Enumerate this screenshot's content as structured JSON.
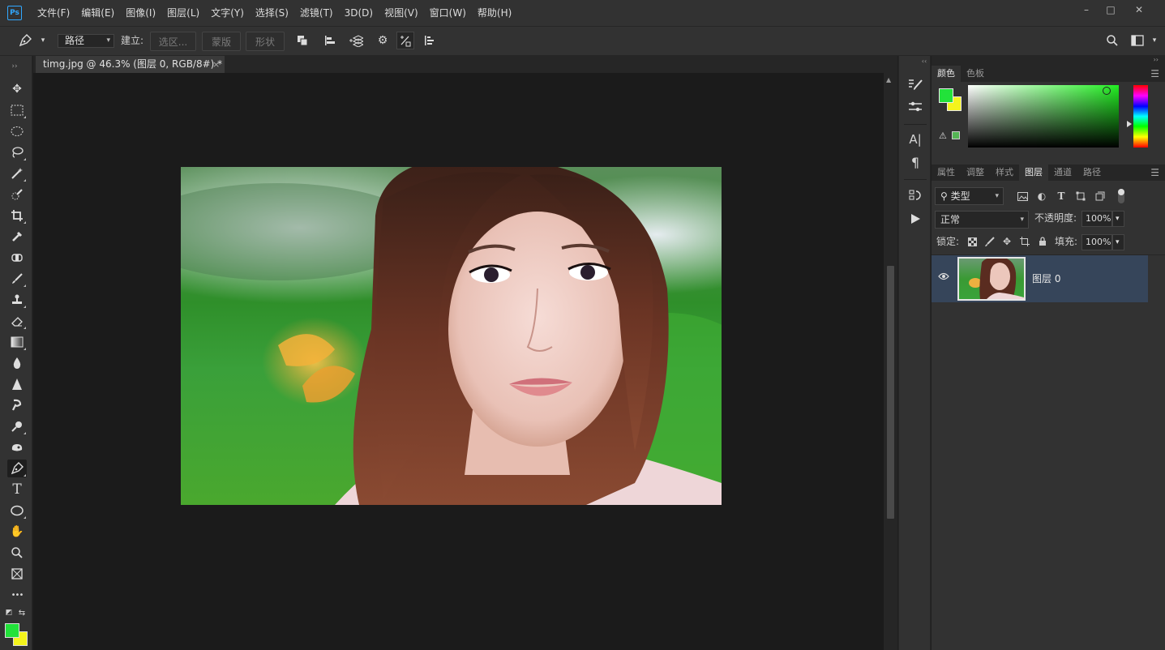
{
  "app": {
    "logo": "Ps",
    "menu": [
      "文件(F)",
      "编辑(E)",
      "图像(I)",
      "图层(L)",
      "文字(Y)",
      "选择(S)",
      "滤镜(T)",
      "3D(D)",
      "视图(V)",
      "窗口(W)",
      "帮助(H)"
    ],
    "window_controls": {
      "minimize": "–",
      "maximize": "□",
      "close": "✕"
    }
  },
  "options_bar": {
    "mode_select": "路径",
    "make_label": "建立:",
    "selection_button": "选区...",
    "mask_button": "蒙版",
    "shape_button": "形状"
  },
  "document": {
    "tab_title": "timg.jpg @ 46.3% (图层 0, RGB/8#) *",
    "close_glyph": "×"
  },
  "color_panel": {
    "tabs": [
      "颜色",
      "色板"
    ],
    "active_tab": "颜色",
    "foreground": "#22e23a",
    "background": "#f4f41c"
  },
  "layers_panel": {
    "tabs": [
      "属性",
      "调整",
      "样式",
      "图层",
      "通道",
      "路径"
    ],
    "active_tab": "图层",
    "filter_kind": "类型",
    "blend_mode": "正常",
    "opacity_label": "不透明度:",
    "opacity_value": "100%",
    "lock_label": "锁定:",
    "fill_label": "填充:",
    "fill_value": "100%",
    "layers": [
      {
        "name": "图层 0",
        "visible": true,
        "selected": true
      }
    ]
  },
  "icons": {
    "pen": "✒",
    "move": "✥",
    "marquee": "⬚",
    "ellipse": "◯",
    "lasso": "◌",
    "magic": "✦",
    "crop": "⌗",
    "text": "T",
    "hand": "✋",
    "zoom": "⚲",
    "more": "•••"
  }
}
